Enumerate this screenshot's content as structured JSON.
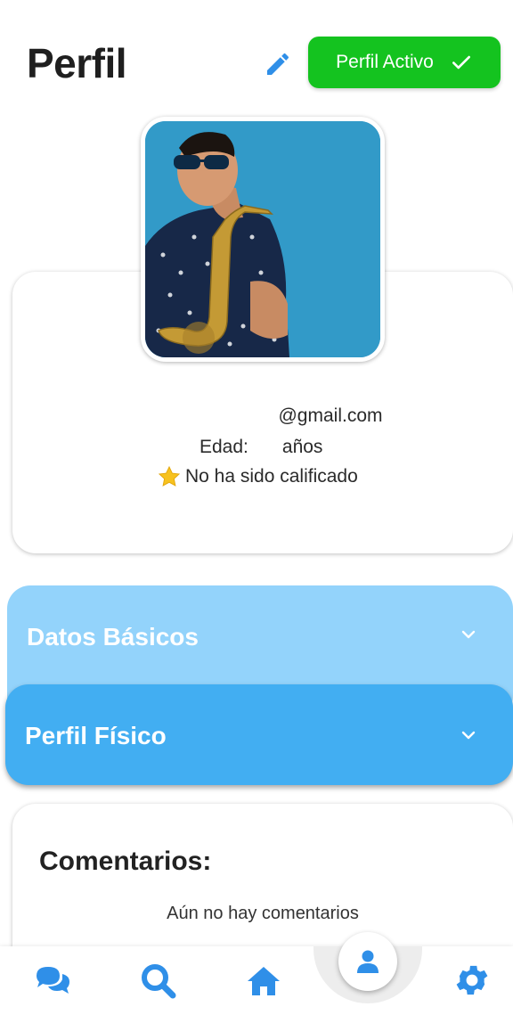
{
  "header": {
    "title": "Perfil",
    "status_label": "Perfil Activo"
  },
  "profile": {
    "email": "@gmail.com",
    "age_label": "Edad:",
    "age_unit": "años",
    "rating_text": "No ha sido calificado"
  },
  "sections": {
    "basic": {
      "label": "Datos Básicos"
    },
    "physical": {
      "label": "Perfil Físico"
    }
  },
  "comments": {
    "title": "Comentarios:",
    "empty_text": "Aún no hay comentarios"
  },
  "nav": {
    "items": [
      "chat-icon",
      "search-icon",
      "home-icon",
      "user-icon",
      "gear-icon"
    ]
  },
  "colors": {
    "accent": "#3d9ff0",
    "status_green": "#14c31f",
    "accordion_light": "#93d3fb",
    "accordion_dark": "#42aef2"
  }
}
